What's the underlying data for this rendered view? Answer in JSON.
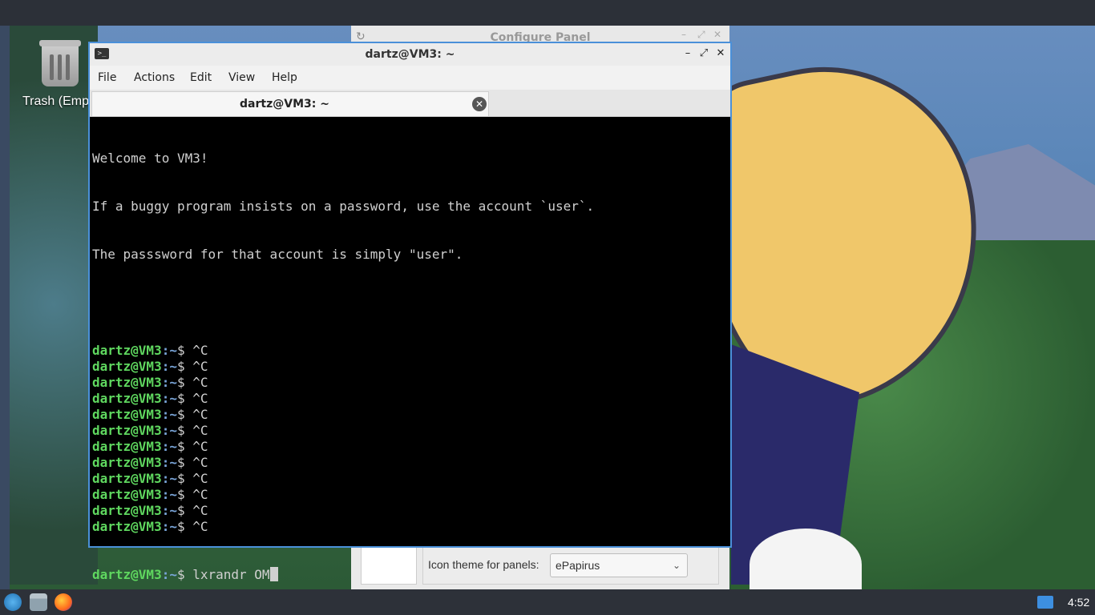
{
  "desktop": {
    "trash_label": "Trash (Empt"
  },
  "configure_panel": {
    "title": "Configure Panel",
    "icon_theme_label": "Icon theme for panels:",
    "icon_theme_value": "ePapirus"
  },
  "terminal": {
    "title": "dartz@VM3: ~",
    "menu": [
      "File",
      "Actions",
      "Edit",
      "View",
      "Help"
    ],
    "tab_label": "dartz@VM3: ~",
    "welcome_lines": [
      "Welcome to VM3!",
      "If a buggy program insists on a password, use the account `user`.",
      "The passsword for that account is simply \"user\"."
    ],
    "prompt_user": "dartz@VM3",
    "prompt_path": ":~",
    "prompt_symbol": "$ ",
    "history": [
      "^C",
      "^C",
      "^C",
      "^C",
      "^C",
      "^C",
      "^C",
      "^C",
      "^C",
      "^C",
      "^C",
      "^C"
    ],
    "current_command": "lxrandr OM"
  },
  "taskbar": {
    "clock": "4:52",
    "icons": [
      "start-menu-icon",
      "file-manager-icon",
      "firefox-icon",
      "notification-tray-icon"
    ]
  },
  "colors": {
    "prompt_user": "#5fd75f",
    "prompt_path": "#7aa6da",
    "window_border": "#4a90d9",
    "taskbar": "#2d3139"
  }
}
